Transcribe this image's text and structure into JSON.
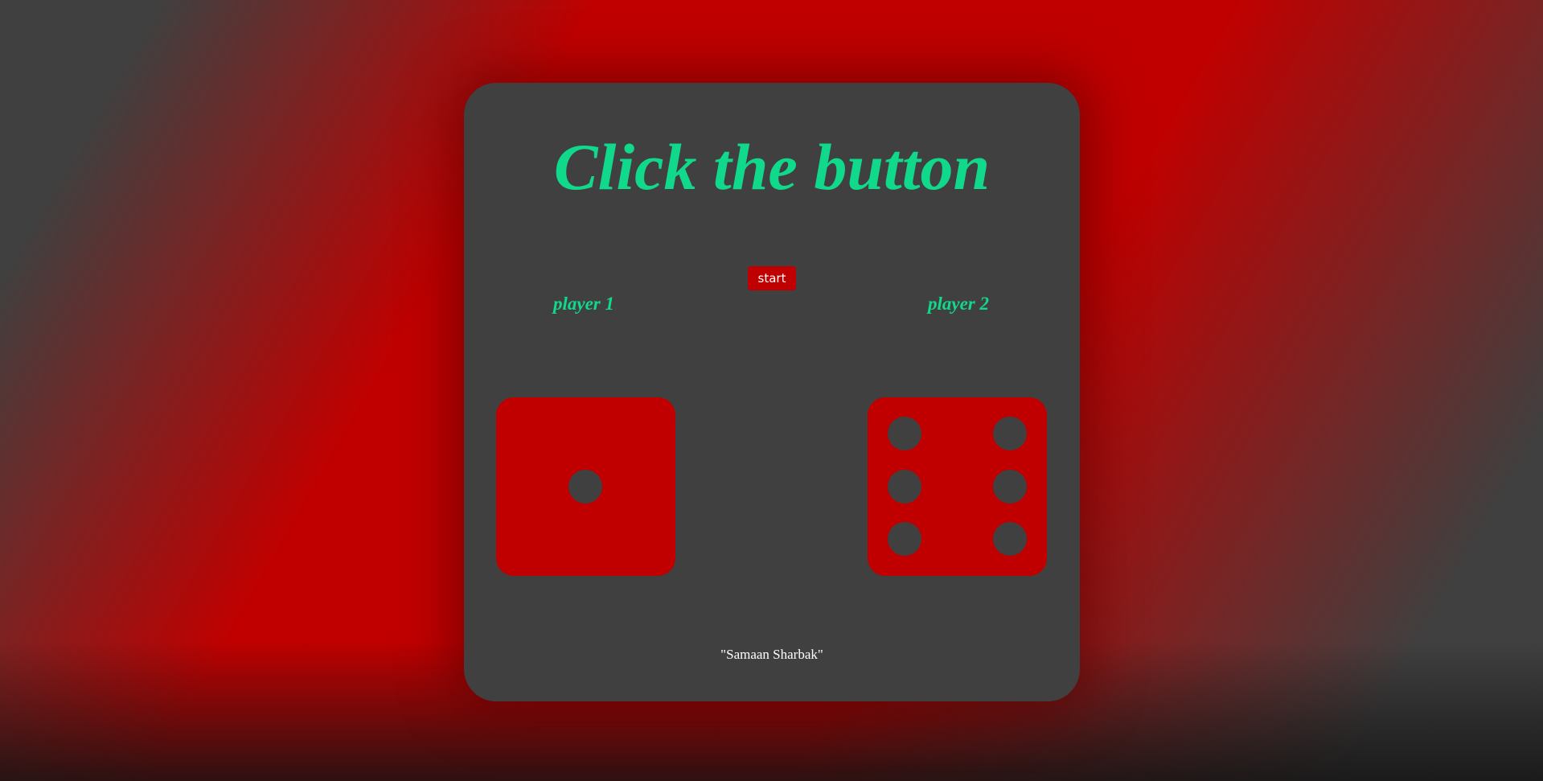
{
  "title": "Click the button",
  "start_button": "start",
  "players": [
    {
      "label": "player 1",
      "die_value": 1
    },
    {
      "label": "player 2",
      "die_value": 6
    }
  ],
  "footer": "\"Samaan Sharbak\"",
  "colors": {
    "accent_green": "#11d98c",
    "brand_red": "#c00000",
    "card_gray": "#404040"
  }
}
